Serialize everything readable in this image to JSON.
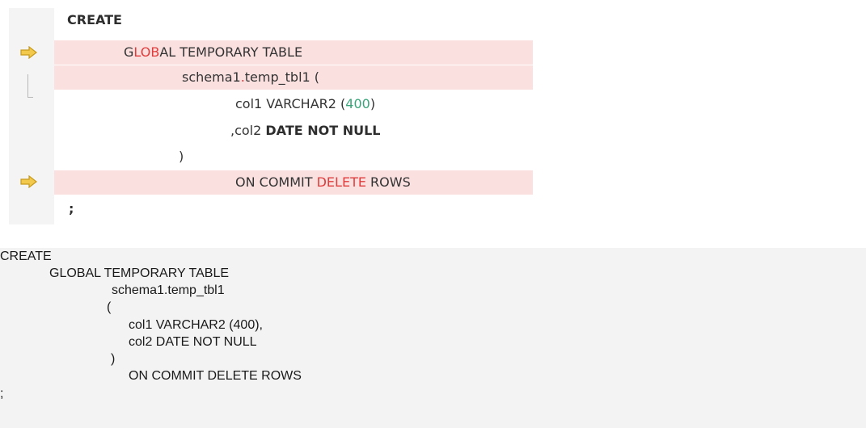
{
  "diff": {
    "lines": [
      {
        "parts": [
          {
            "t": "CREATE",
            "c": "kw"
          }
        ]
      },
      {
        "parts": [
          {
            "t": "G"
          },
          {
            "t": "LOB",
            "c": "red"
          },
          {
            "t": "AL TEMPORARY TABLE"
          }
        ]
      },
      {
        "parts": [
          {
            "t": "schema1"
          },
          {
            "t": ".",
            "c": "red"
          },
          {
            "t": "temp_tbl1 ("
          }
        ]
      },
      {
        "parts": [
          {
            "t": "col1 VARCHAR2 ("
          },
          {
            "t": "400",
            "c": "grn"
          },
          {
            "t": ")"
          }
        ]
      },
      {
        "parts": [
          {
            "t": ",col2 "
          },
          {
            "t": "DATE NOT NULL",
            "c": "kw"
          }
        ]
      },
      {
        "parts": [
          {
            "t": ")"
          }
        ]
      },
      {
        "parts": [
          {
            "t": "ON COMMIT "
          },
          {
            "t": "DELETE",
            "c": "red"
          },
          {
            "t": " ROWS"
          }
        ]
      },
      {
        "parts": [
          {
            "t": ";",
            "c": "kw"
          }
        ]
      }
    ]
  },
  "plain": {
    "lines": [
      "CREATE",
      "GLOBAL TEMPORARY TABLE",
      "schema1.temp_tbl1",
      "(",
      "col1 VARCHAR2 (400),",
      "col2 DATE NOT NULL",
      ")",
      "ON COMMIT DELETE ROWS",
      ";"
    ]
  },
  "colors": {
    "changed_bg": "#fbe0e0",
    "marker": "#f2c94c",
    "deleted_text": "#e03c3c",
    "number_text": "#3aa57a"
  },
  "icons": {
    "change_marker": "arrow-right-icon",
    "fold": "fold-bracket-icon"
  }
}
